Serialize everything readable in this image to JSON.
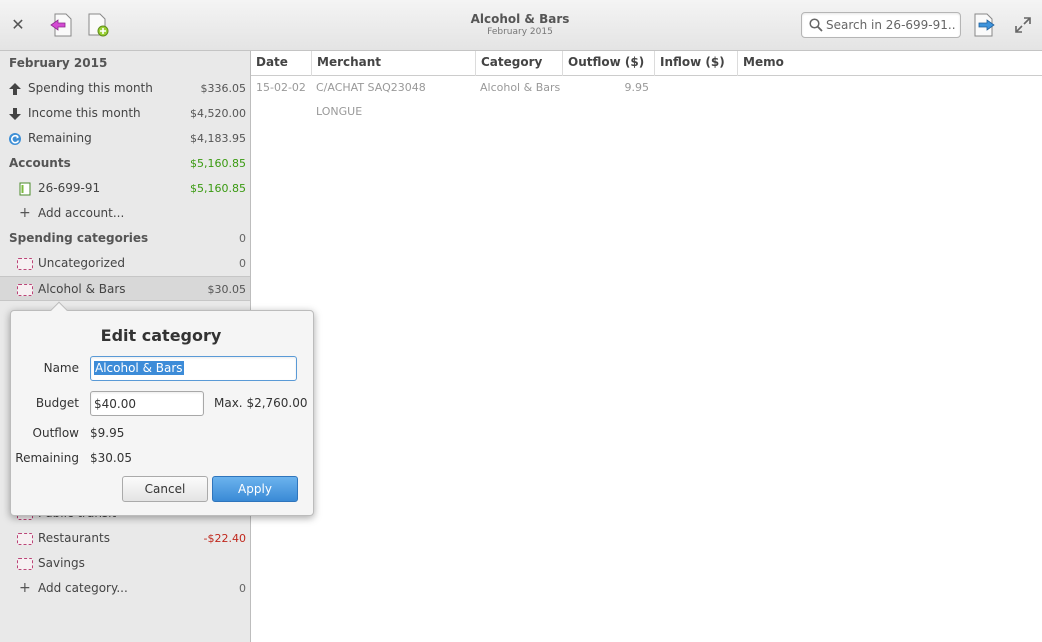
{
  "header": {
    "title": "Alcohol & Bars",
    "subtitle": "February 2015",
    "search_placeholder": "Search in 26-699-91..."
  },
  "sidebar": {
    "month_heading": "February 2015",
    "summary": [
      {
        "label": "Spending this month",
        "amount": "$336.05",
        "icon": "arrow-up-icon"
      },
      {
        "label": "Income this month",
        "amount": "$4,520.00",
        "icon": "arrow-down-icon"
      },
      {
        "label": "Remaining",
        "amount": "$4,183.95",
        "icon": "refresh-icon"
      }
    ],
    "accounts_heading": "Accounts",
    "accounts_total": "$5,160.85",
    "accounts": [
      {
        "label": "26-699-91",
        "amount": "$5,160.85"
      }
    ],
    "add_account": "Add account...",
    "categories_heading": "Spending categories",
    "categories_total": "0",
    "categories": [
      {
        "label": "Uncategorized",
        "amount": "0"
      },
      {
        "label": "Alcohol & Bars",
        "amount": "$30.05"
      },
      {
        "label": "Public transit",
        "amount": ""
      },
      {
        "label": "Restaurants",
        "amount": "-$22.40"
      },
      {
        "label": "Savings",
        "amount": ""
      }
    ],
    "add_category": "Add category...",
    "add_category_amount": "0"
  },
  "table": {
    "columns": [
      "Date",
      "Merchant",
      "Category",
      "Outflow ($)",
      "Inflow ($)",
      "Memo"
    ],
    "rows": [
      {
        "date": "15-02-02",
        "merchant": "C/ACHAT SAQ23048 LONGUE",
        "category": "Alcohol & Bars",
        "outflow": "9.95",
        "inflow": "",
        "memo": ""
      }
    ]
  },
  "dialog": {
    "title": "Edit category",
    "name_label": "Name",
    "name_value": "Alcohol & Bars",
    "budget_label": "Budget",
    "budget_value": "$40.00",
    "max_label": "Max. $2,760.00",
    "outflow_label": "Outflow",
    "outflow_value": "$9.95",
    "remaining_label": "Remaining",
    "remaining_value": "$30.05",
    "cancel_label": "Cancel",
    "apply_label": "Apply"
  },
  "colors": {
    "positive": "#3a9a11",
    "negative": "#c0281d",
    "accent": "#3a8ad6"
  }
}
